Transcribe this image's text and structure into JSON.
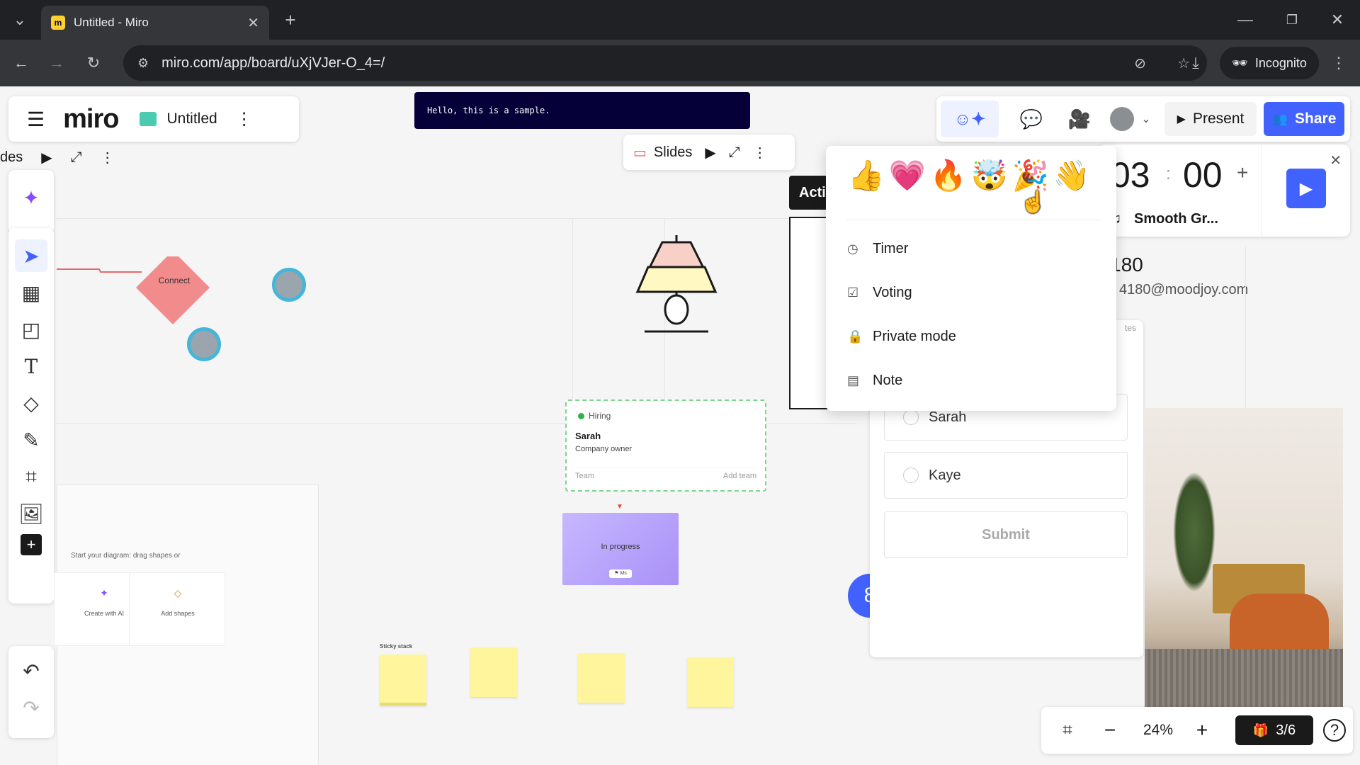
{
  "browser": {
    "tab_title": "Untitled - Miro",
    "favicon_letter": "m",
    "url": "miro.com/app/board/uXjVJer-O_4=/",
    "incognito_label": "Incognito"
  },
  "miro": {
    "logo": "miro",
    "board_title": "Untitled",
    "code_banner": "Hello, this is a sample.",
    "slides_label": "Slides",
    "slides_left_partial": "des",
    "present_label": "Present",
    "share_label": "Share"
  },
  "reactions": {
    "emojis": [
      "👍",
      "💗",
      "🔥",
      "🤯",
      "🎉",
      "👋"
    ],
    "menu": [
      {
        "label": "Timer",
        "icon": "timer-icon"
      },
      {
        "label": "Voting",
        "icon": "voting-icon"
      },
      {
        "label": "Private mode",
        "icon": "private-mode-icon"
      },
      {
        "label": "Note",
        "icon": "note-icon"
      }
    ]
  },
  "timer": {
    "minutes_partial": "03",
    "separator": ":",
    "seconds": "00",
    "plus": "+",
    "music": "Smooth Gr..."
  },
  "profile": {
    "id_partial": "24180",
    "email_partial": "4180@moodjoy.com",
    "small_partial": "tes"
  },
  "voting": {
    "options": [
      "Sarah",
      "Kaye"
    ],
    "submit_label": "Submit"
  },
  "canvas": {
    "diamond_label": "Connect",
    "card_tag": "Hiring",
    "card_name": "Sarah",
    "card_role": "Company owner",
    "card_team": "Team",
    "card_add_team": "Add team",
    "in_progress_label": "In progress",
    "in_progress_badge": "⚑ Ms",
    "diagram_hint": "Start your diagram: drag shapes or",
    "create_ai": "Create with AI",
    "add_shapes": "Add shapes",
    "sticky_stack": "Sticky stack",
    "action_partial": "Acti",
    "collaborator_count": "8"
  },
  "bottom": {
    "zoom": "24%",
    "page_count": "3/6"
  },
  "colors": {
    "accent": "#4262ff",
    "code_banner_bg": "#050038",
    "diamond": "#f28b8b",
    "sticky": "#fff59c",
    "in_progress": "#b8a8f8"
  }
}
